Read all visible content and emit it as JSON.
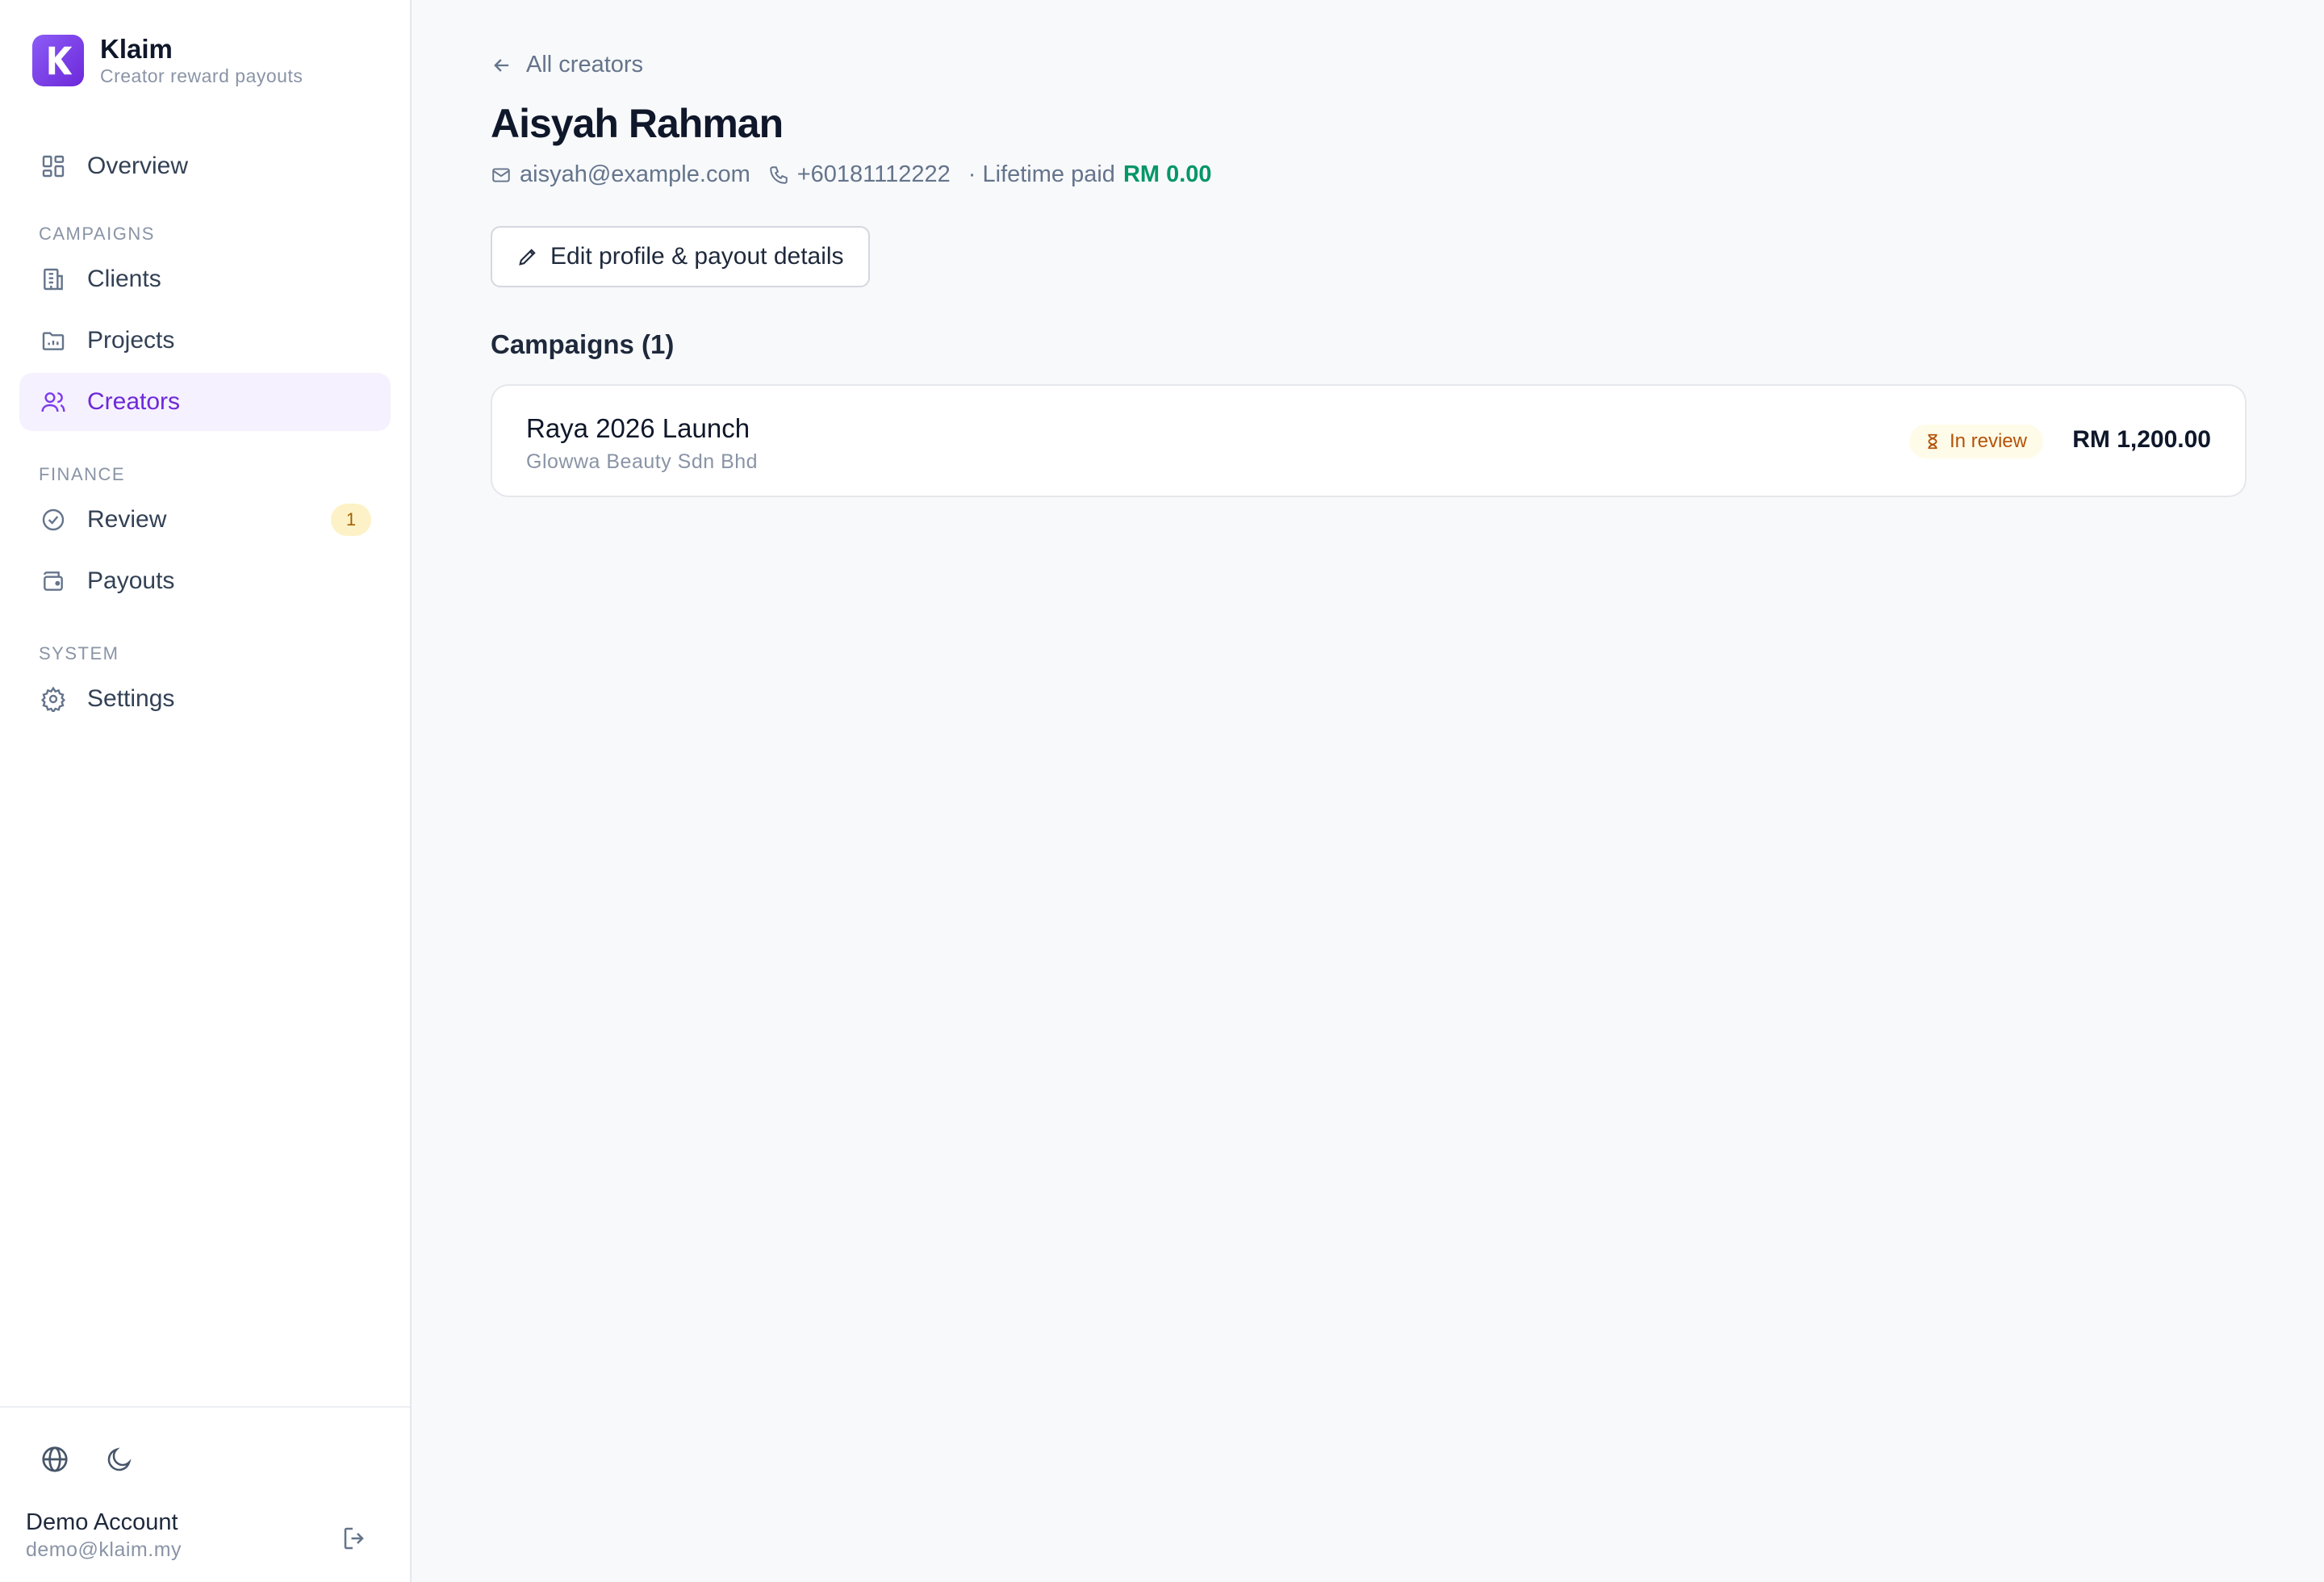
{
  "brand": {
    "name": "Klaim",
    "subtitle": "Creator reward payouts",
    "accent": "#7c3aed"
  },
  "sidebar": {
    "overview": {
      "label": "Overview",
      "icon": "layout-grid-icon"
    },
    "sections": [
      {
        "title": "CAMPAIGNS",
        "items": [
          {
            "label": "Clients",
            "icon": "building-icon"
          },
          {
            "label": "Projects",
            "icon": "folder-chart-icon"
          },
          {
            "label": "Creators",
            "icon": "users-icon",
            "active": true
          }
        ]
      },
      {
        "title": "FINANCE",
        "items": [
          {
            "label": "Review",
            "icon": "check-circle-icon",
            "badge": "1"
          },
          {
            "label": "Payouts",
            "icon": "wallet-icon"
          }
        ]
      },
      {
        "title": "SYSTEM",
        "items": [
          {
            "label": "Settings",
            "icon": "gear-icon"
          }
        ]
      }
    ]
  },
  "footer": {
    "account_name": "Demo Account",
    "account_email": "demo@klaim.my"
  },
  "main": {
    "back_label": "All creators",
    "creator_name": "Aisyah Rahman",
    "email": "aisyah@example.com",
    "phone": "+60181112222",
    "lifetime_label": "· Lifetime paid",
    "lifetime_value": "RM 0.00",
    "edit_label": "Edit profile & payout details",
    "campaigns_title": "Campaigns (1)",
    "campaigns": [
      {
        "name": "Raya 2026 Launch",
        "client": "Glowwa Beauty Sdn Bhd",
        "status": "In review",
        "amount": "RM 1,200.00"
      }
    ]
  },
  "colors": {
    "active_bg": "#f5f1fe",
    "paid_green": "#059669",
    "status_bg": "#fefbe8",
    "status_text": "#b45309"
  }
}
